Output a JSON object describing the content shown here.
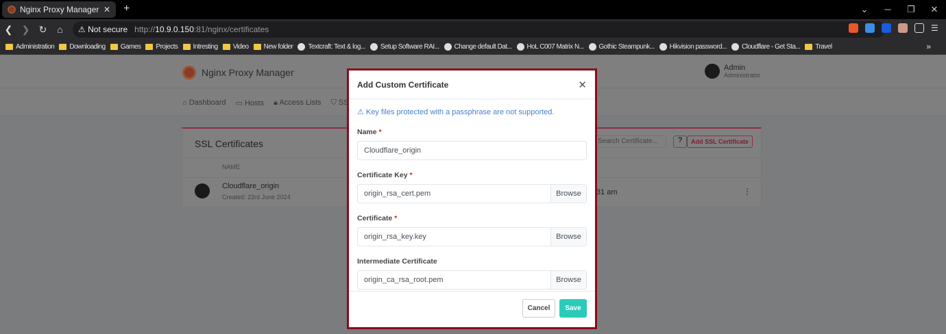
{
  "browser": {
    "tab_title": "Nginx Proxy Manager",
    "not_secure": "Not secure",
    "url_prefix": "http://",
    "url_host": "10.9.0.150",
    "url_rest": ":81/nginx/certificates",
    "bookmarks": [
      {
        "label": "Administration",
        "icon": "folder-icon"
      },
      {
        "label": "Downloading",
        "icon": "folder-icon"
      },
      {
        "label": "Games",
        "icon": "folder-icon"
      },
      {
        "label": "Projects",
        "icon": "folder-icon"
      },
      {
        "label": "Intresting",
        "icon": "folder-icon"
      },
      {
        "label": "Video",
        "icon": "folder-icon"
      },
      {
        "label": "New folder",
        "icon": "folder-icon"
      },
      {
        "label": "Textcraft: Text & log...",
        "icon": "globe-icon"
      },
      {
        "label": "Setup Software RAI...",
        "icon": "globe-icon"
      },
      {
        "label": "Change default Dat...",
        "icon": "globe-icon"
      },
      {
        "label": "HoL C007 Matrix N...",
        "icon": "globe-icon"
      },
      {
        "label": "Gothic Steampunk...",
        "icon": "globe-icon"
      },
      {
        "label": "Hikvision password...",
        "icon": "globe-icon"
      },
      {
        "label": "Cloudflare - Get Sta...",
        "icon": "globe-icon"
      },
      {
        "label": "Travel",
        "icon": "folder-icon"
      }
    ]
  },
  "app": {
    "title": "Nginx Proxy Manager",
    "user_name": "Admin",
    "user_role": "Administrator",
    "nav": [
      "Dashboard",
      "Hosts",
      "Access Lists",
      "SSL"
    ],
    "card_title": "SSL Certificates",
    "search_placeholder": "Search Certificate...",
    "add_button": "Add SSL Certificate",
    "col_name": "NAME",
    "row": {
      "name": "Cloudflare_origin",
      "created": "Created: 23rd June 2024",
      "time": "31 am"
    }
  },
  "modal": {
    "title": "Add Custom Certificate",
    "warning": "Key files protected with a passphrase are not supported.",
    "fields": [
      {
        "label": "Name",
        "required": "*",
        "value": "Cloudflare_origin"
      },
      {
        "label": "Certificate Key",
        "required": "*",
        "value": "origin_rsa_cert.pem",
        "browse": "Browse"
      },
      {
        "label": "Certificate",
        "required": "*",
        "value": "origin_rsa_key.key",
        "browse": "Browse"
      },
      {
        "label": "Intermediate Certificate",
        "value": "origin_ca_rsa_root.pem",
        "browse": "Browse"
      }
    ],
    "cancel": "Cancel",
    "save": "Save"
  }
}
